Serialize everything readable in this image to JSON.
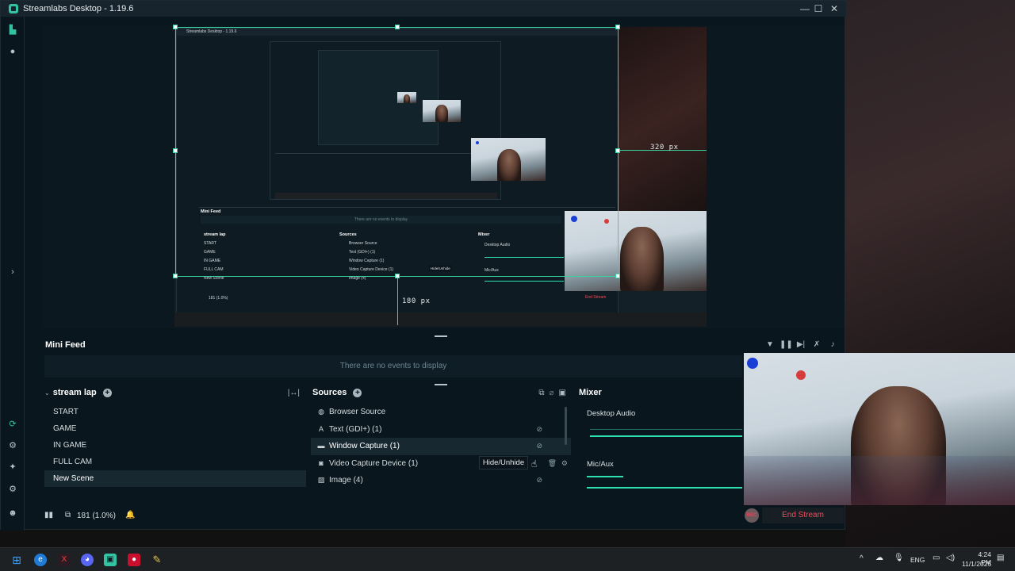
{
  "window": {
    "title": "Streamlabs Desktop - 1.19.6"
  },
  "preview": {
    "inner_title": "Streamlabs Desktop - 1.19.6",
    "measure_right": "320 px",
    "measure_bottom": "180 px",
    "measure_inner_right": "320 px",
    "measure_inner_bottom": "180 px",
    "inner_minifeed": "Mini Feed",
    "inner_empty": "There are no events to display",
    "inner_scenes_title": "stream lap",
    "inner_scenes": [
      "START",
      "GAME",
      "IN GAME",
      "FULL CAM",
      "New Scene"
    ],
    "inner_sources_title": "Sources",
    "inner_sources": [
      "Browser Source",
      "Text (GDI+) (1)",
      "Window Capture (1)",
      "Video Capture Device (1)",
      "Image (4)"
    ],
    "inner_mixer_title": "Mixer",
    "inner_mixer": [
      "Desktop Audio",
      "Mic/Aux"
    ],
    "inner_tooltip": "Hide/Unhide",
    "inner_footer": "181 (1.0%)",
    "inner_end_stream": "End Stream"
  },
  "minifeed": {
    "title": "Mini Feed",
    "empty_text": "There are no events to display"
  },
  "scenes": {
    "collection": "stream lap",
    "items": [
      "START",
      "GAME",
      "IN GAME",
      "FULL CAM",
      "New Scene"
    ],
    "active_index": 4
  },
  "sources": {
    "title": "Sources",
    "items": [
      {
        "label": "Browser Source",
        "icon": "globe-icon"
      },
      {
        "label": "Text (GDI+) (1)",
        "icon": "text-icon"
      },
      {
        "label": "Window Capture (1)",
        "icon": "window-icon"
      },
      {
        "label": "Video Capture Device (1)",
        "icon": "camera-icon"
      },
      {
        "label": "Image (4)",
        "icon": "image-icon"
      }
    ],
    "active_index": 2,
    "tooltip": "Hide/Unhide"
  },
  "mixer": {
    "title": "Mixer",
    "channels": [
      {
        "name": "Desktop Audio"
      },
      {
        "name": "Mic/Aux"
      }
    ]
  },
  "footer": {
    "performance": "181 (1.0%)",
    "end_stream": "End Stream",
    "rec_label": "REC"
  },
  "taskbar": {
    "language": "ENG",
    "time": "4:24 PM",
    "date": "11/1/2025"
  },
  "colors": {
    "accent": "#38d3a0",
    "end_stream": "#ee4d5b",
    "bg": "#09161d"
  }
}
